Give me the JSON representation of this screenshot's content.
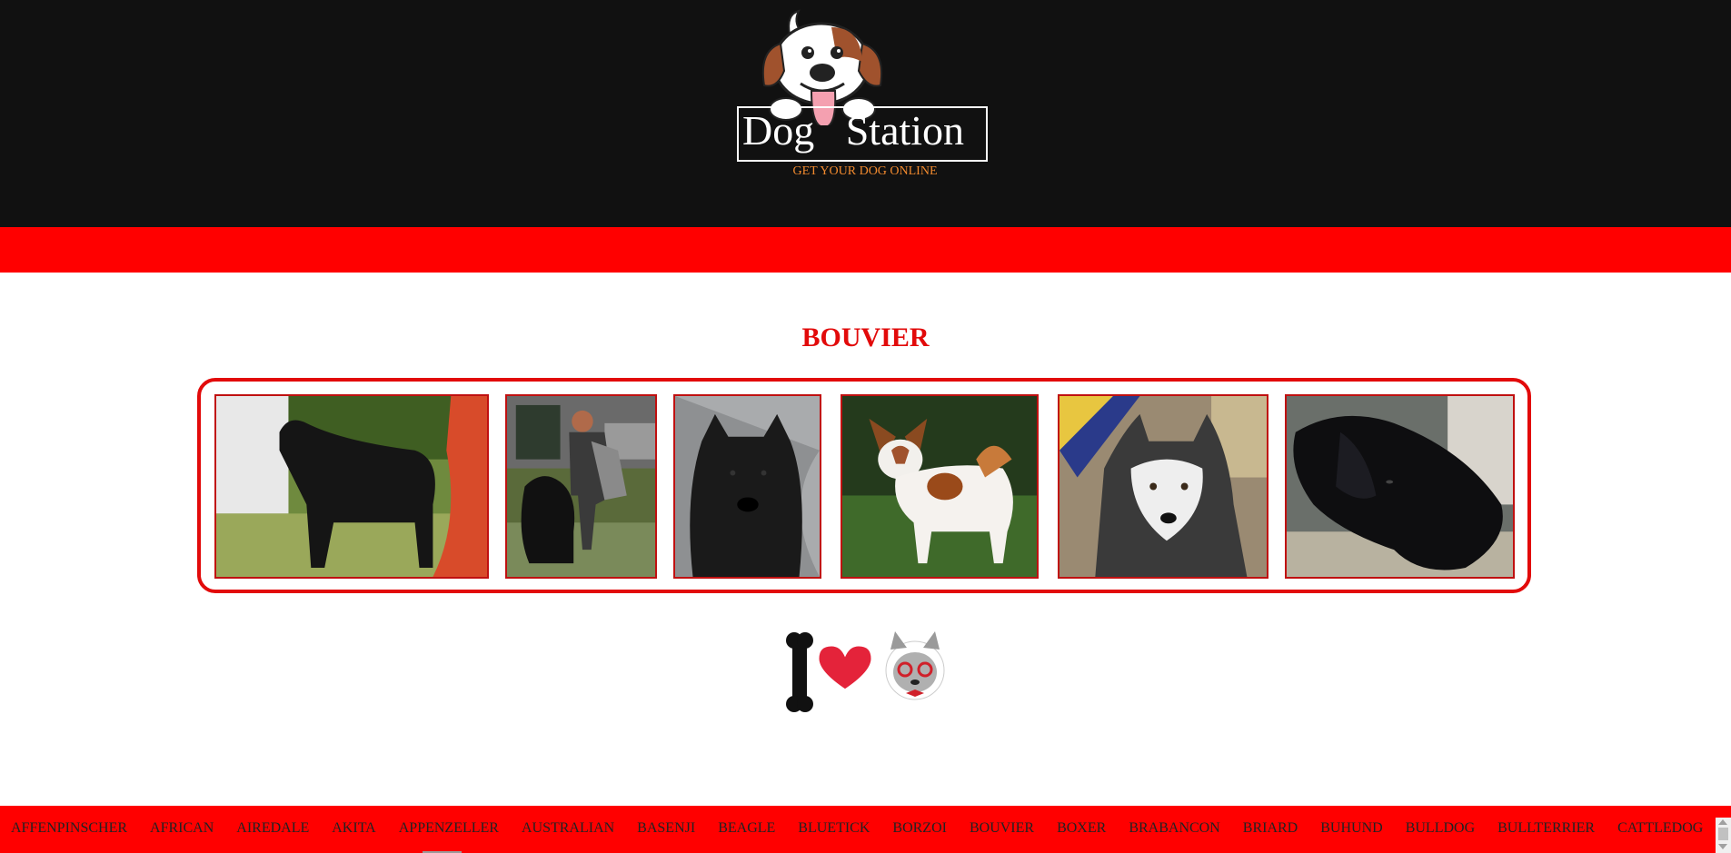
{
  "header": {
    "logo_text": "Dog   Station",
    "tagline": "GET YOUR DOG ONLINE"
  },
  "breed_title": "BOUVIER",
  "gallery": {
    "photos": [
      {
        "subject": "black-shaggy-dog-standing"
      },
      {
        "subject": "person-with-black-dog"
      },
      {
        "subject": "black-dog-portrait"
      },
      {
        "subject": "papillon-dog-on-grass"
      },
      {
        "subject": "husky-face"
      },
      {
        "subject": "black-dog-lying-down"
      }
    ]
  },
  "footer": {
    "breeds": [
      "AFFENPINSCHER",
      "AFRICAN",
      "AIREDALE",
      "AKITA",
      "APPENZELLER",
      "AUSTRALIAN",
      "BASENJI",
      "BEAGLE",
      "BLUETICK",
      "BORZOI",
      "BOUVIER",
      "BOXER",
      "BRABANCON",
      "BRIARD",
      "BUHUND",
      "BULLDOG",
      "BULLTERRIER",
      "CATTLEDOG"
    ]
  },
  "colors": {
    "header_bg": "#111111",
    "accent_red": "#ff0000",
    "title_red": "#e20a0a",
    "tagline_orange": "#f28a2e"
  }
}
